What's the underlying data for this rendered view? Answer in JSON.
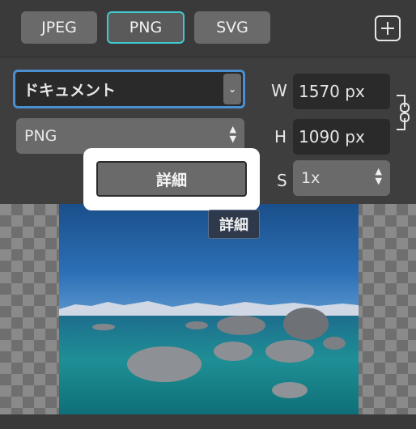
{
  "format_tabs": [
    {
      "label": "JPEG",
      "active": false
    },
    {
      "label": "PNG",
      "active": true
    },
    {
      "label": "SVG",
      "active": false
    }
  ],
  "add_button_icon": "plus-icon",
  "document_select": {
    "value": "ドキュメント"
  },
  "format_select": {
    "value": "PNG"
  },
  "width": {
    "label": "W",
    "value": "1570 px"
  },
  "height": {
    "label": "H",
    "value": "1090 px"
  },
  "scale": {
    "label": "S",
    "value": "1x"
  },
  "details_button": {
    "label": "詳細"
  },
  "tooltip": {
    "text": "詳細"
  },
  "colors": {
    "accent": "#3fc8d0",
    "focus": "#4a8fcf"
  }
}
